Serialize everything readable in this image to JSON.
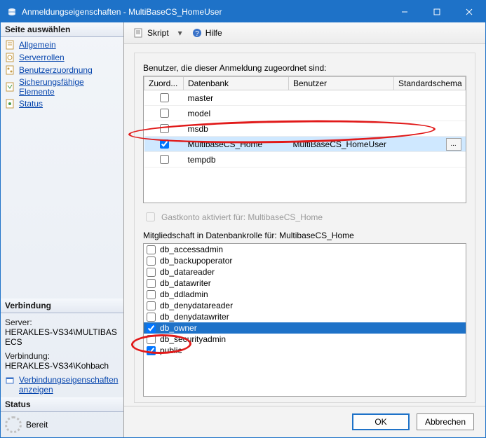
{
  "window": {
    "title": "Anmeldungseigenschaften - MultiBaseCS_HomeUser"
  },
  "sidebar": {
    "page_select_header": "Seite auswählen",
    "items": [
      {
        "label": "Allgemein"
      },
      {
        "label": "Serverrollen"
      },
      {
        "label": "Benutzerzuordnung"
      },
      {
        "label": "Sicherungsfähige Elemente"
      },
      {
        "label": "Status"
      }
    ],
    "connection_header": "Verbindung",
    "server_label": "Server:",
    "server_value": "HERAKLES-VS34\\MULTIBASECS",
    "connection_label": "Verbindung:",
    "connection_value": "HERAKLES-VS34\\Kohbach",
    "conn_props_link": "Verbindungseigenschaften anzeigen",
    "status_header": "Status",
    "status_value": "Bereit"
  },
  "toolbar": {
    "script_label": "Skript",
    "help_label": "Hilfe"
  },
  "mapping": {
    "label": "Benutzer, die dieser Anmeldung zugeordnet sind:",
    "columns": {
      "map": "Zuord...",
      "database": "Datenbank",
      "user": "Benutzer",
      "default_schema": "Standardschema"
    },
    "rows": [
      {
        "checked": false,
        "database": "master",
        "user": "",
        "schema": ""
      },
      {
        "checked": false,
        "database": "model",
        "user": "",
        "schema": ""
      },
      {
        "checked": false,
        "database": "msdb",
        "user": "",
        "schema": ""
      },
      {
        "checked": true,
        "database": "MultibaseCS_Home",
        "user": "MultiBaseCS_HomeUser",
        "schema": "",
        "selected": true
      },
      {
        "checked": false,
        "database": "tempdb",
        "user": "",
        "schema": ""
      }
    ]
  },
  "guest": {
    "label": "Gastkonto aktiviert für: MultibaseCS_Home",
    "enabled": false,
    "checked": false
  },
  "roles": {
    "label": "Mitgliedschaft in Datenbankrolle für: MultibaseCS_Home",
    "items": [
      {
        "name": "db_accessadmin",
        "checked": false
      },
      {
        "name": "db_backupoperator",
        "checked": false
      },
      {
        "name": "db_datareader",
        "checked": false
      },
      {
        "name": "db_datawriter",
        "checked": false
      },
      {
        "name": "db_ddladmin",
        "checked": false
      },
      {
        "name": "db_denydatareader",
        "checked": false
      },
      {
        "name": "db_denydatawriter",
        "checked": false
      },
      {
        "name": "db_owner",
        "checked": true,
        "selected": true
      },
      {
        "name": "db_securityadmin",
        "checked": false
      },
      {
        "name": "public",
        "checked": true
      }
    ]
  },
  "footer": {
    "ok": "OK",
    "cancel": "Abbrechen"
  }
}
